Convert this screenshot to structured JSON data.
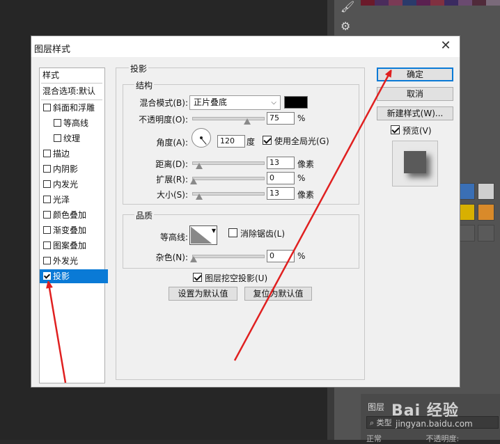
{
  "app": {
    "panel_tab": "图层",
    "filter_text": "类型",
    "mode_value": "正常",
    "opacity_label": "不透明度:",
    "watermark": "Bai 经验",
    "watermark_sub": "jingyan.baidu.com"
  },
  "dialog": {
    "title": "图层样式",
    "close_icon": "close-icon"
  },
  "style_list": {
    "header": "样式",
    "blend_defaults": "混合选项:默认",
    "items": [
      {
        "label": "斜面和浮雕",
        "checked": false,
        "indent": false
      },
      {
        "label": "等高线",
        "checked": false,
        "indent": true
      },
      {
        "label": "纹理",
        "checked": false,
        "indent": true
      },
      {
        "label": "描边",
        "checked": false,
        "indent": false
      },
      {
        "label": "内阴影",
        "checked": false,
        "indent": false
      },
      {
        "label": "内发光",
        "checked": false,
        "indent": false
      },
      {
        "label": "光泽",
        "checked": false,
        "indent": false
      },
      {
        "label": "颜色叠加",
        "checked": false,
        "indent": false
      },
      {
        "label": "渐变叠加",
        "checked": false,
        "indent": false
      },
      {
        "label": "图案叠加",
        "checked": false,
        "indent": false
      },
      {
        "label": "外发光",
        "checked": false,
        "indent": false
      },
      {
        "label": "投影",
        "checked": true,
        "indent": false,
        "selected": true
      }
    ]
  },
  "drop_shadow": {
    "section_title": "投影",
    "structure": {
      "title": "结构",
      "blend_mode_label": "混合模式(B):",
      "blend_mode_value": "正片叠底",
      "shadow_color": "#000000",
      "opacity_label": "不透明度(O):",
      "opacity_value": "75",
      "opacity_unit": "%",
      "opacity_fraction": 0.75,
      "angle_label": "角度(A):",
      "angle_value": "120",
      "angle_unit": "度",
      "global_light_label": "使用全局光(G)",
      "global_light_checked": true,
      "distance_label": "距离(D):",
      "distance_value": "13",
      "distance_unit": "像素",
      "spread_label": "扩展(R):",
      "spread_value": "0",
      "spread_unit": "%",
      "size_label": "大小(S):",
      "size_value": "13",
      "size_unit": "像素"
    },
    "quality": {
      "title": "品质",
      "contour_label": "等高线:",
      "antialias_label": "消除锯齿(L)",
      "antialias_checked": false,
      "noise_label": "杂色(N):",
      "noise_value": "0",
      "noise_unit": "%"
    },
    "knockout_label": "图层挖空投影(U)",
    "knockout_checked": true,
    "make_default_label": "设置为默认值",
    "reset_default_label": "复位为默认值"
  },
  "right_buttons": {
    "ok_label": "确定",
    "cancel_label": "取消",
    "new_style_label": "新建样式(W)...",
    "preview_label": "预览(V)",
    "preview_checked": true
  },
  "annotations": {
    "arrow_color": "#e02020"
  }
}
